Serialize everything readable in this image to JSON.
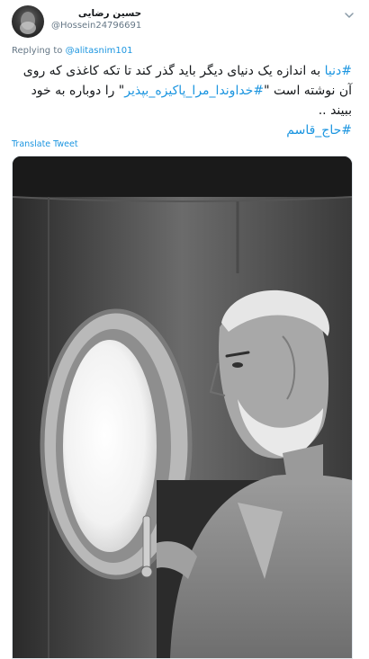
{
  "tweet": {
    "author": {
      "display_name": "حسین رضایی",
      "handle": "@Hossein24796691"
    },
    "replying": {
      "prefix": "Replying to",
      "mention": "@alitasnim101"
    },
    "text": {
      "hashtag_1": "#دنیا",
      "body_1": " به اندازه یک دنیای دیگر باید گذر کند تا تکه کاغذی که روی آن نوشته است \"",
      "hashtag_2": "#خداوندا_مرا_پاکیزه_بپذیر",
      "body_2": "\" را دوباره به خود ببیند ..",
      "hashtag_3": "#حاج_قاسم"
    },
    "translate_label": "Translate Tweet",
    "icons": {
      "caret": "chevron-down-icon",
      "avatar": "avatar-photo"
    },
    "colors": {
      "link": "#1b95e0",
      "secondary_text": "#657786",
      "primary_text": "#14171a"
    }
  }
}
